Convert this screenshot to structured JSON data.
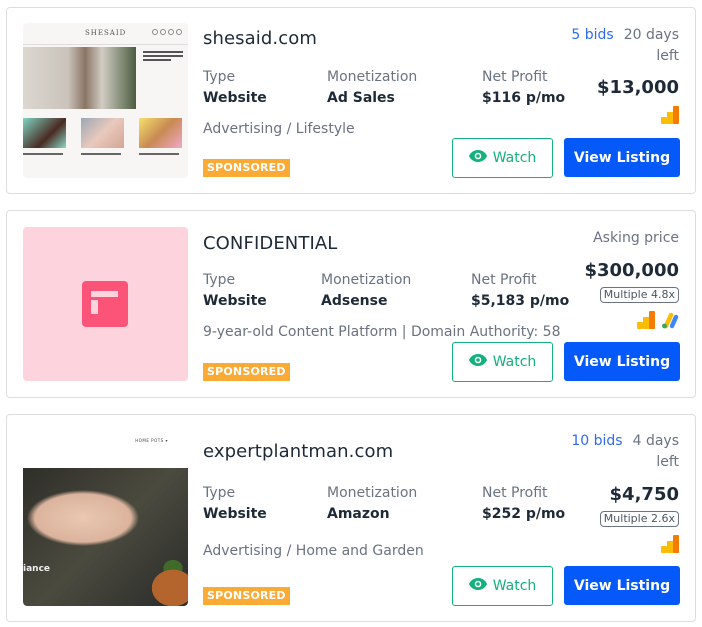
{
  "labels": {
    "type": "Type",
    "monetization": "Monetization",
    "net_profit": "Net Profit",
    "sponsored": "SPONSORED",
    "watch": "Watch",
    "view_listing": "View Listing",
    "asking_price": "Asking price"
  },
  "colors": {
    "accent_blue": "#0459f8",
    "watch_green": "#13b27c",
    "sponsored_orange": "#fbab35",
    "bids_blue": "#2f6bf1",
    "confidential_pink": "#fb5478"
  },
  "listings": [
    {
      "title": "shesaid.com",
      "thumbnail": {
        "icon": "site-screenshot-shesaid",
        "logo_text": "SHESAID"
      },
      "type": "Website",
      "monetization": "Ad Sales",
      "net_profit": "$116 p/mo",
      "description": "Advertising / Lifestyle",
      "bids": "5 bids",
      "time_left": "20 days left",
      "price": "$13,000",
      "multiple": null,
      "integrations": [
        "google-analytics-icon"
      ]
    },
    {
      "title": "CONFIDENTIAL",
      "thumbnail": {
        "icon": "confidential-listing-icon"
      },
      "type": "Website",
      "monetization": "Adsense",
      "net_profit": "$5,183 p/mo",
      "description": "9-year-old Content Platform | Domain Authority: 58",
      "price_label": "Asking price",
      "price": "$300,000",
      "multiple": "Multiple 4.8x",
      "integrations": [
        "google-analytics-icon",
        "google-adsense-icon"
      ]
    },
    {
      "title": "expertplantman.com",
      "thumbnail": {
        "icon": "site-screenshot-expertplantman",
        "nav_text": "HOME   POTS ▾",
        "overlay_text": "iance"
      },
      "type": "Website",
      "monetization": "Amazon",
      "net_profit": "$252 p/mo",
      "description": "Advertising / Home and Garden",
      "bids": "10 bids",
      "time_left": "4 days left",
      "price": "$4,750",
      "multiple": "Multiple 2.6x",
      "integrations": [
        "google-analytics-icon"
      ]
    }
  ]
}
